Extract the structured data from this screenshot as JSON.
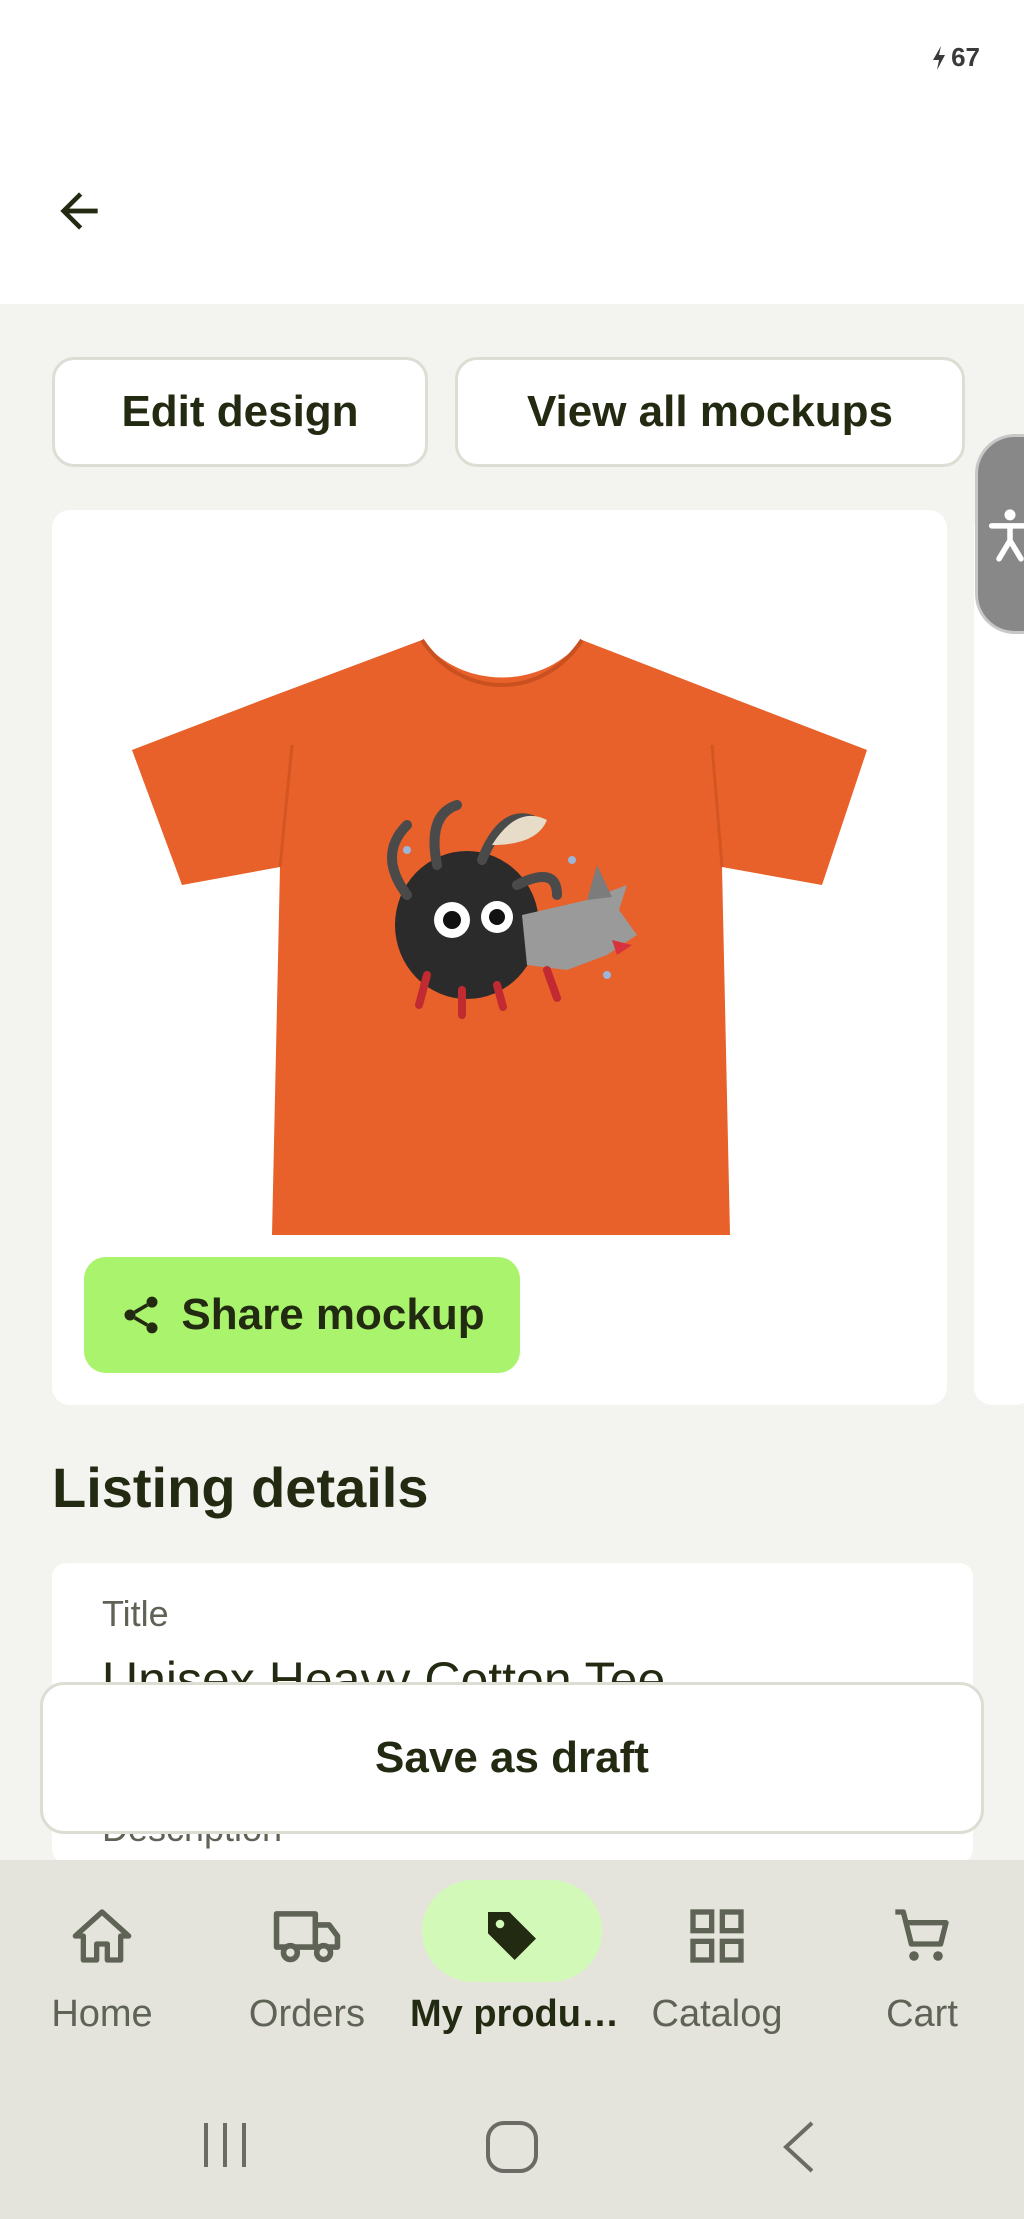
{
  "status_bar": {
    "battery": "67"
  },
  "actions": {
    "edit_design": "Edit design",
    "view_all_mockups": "View all mockups"
  },
  "mockup": {
    "product_color": "#e8602a",
    "share_label": "Share mockup"
  },
  "listing": {
    "section_title": "Listing details",
    "title_label": "Title",
    "title_value": "Unisex Heavy Cotton Tee",
    "description_label": "Description"
  },
  "save_draft_label": "Save as draft",
  "bottom_nav": {
    "items": [
      {
        "label": "Home",
        "icon": "home-icon"
      },
      {
        "label": "Orders",
        "icon": "truck-icon"
      },
      {
        "label": "My produ…",
        "icon": "tag-icon",
        "active": true
      },
      {
        "label": "Catalog",
        "icon": "grid-icon"
      },
      {
        "label": "Cart",
        "icon": "cart-icon"
      }
    ]
  },
  "colors": {
    "accent": "#a9f46c",
    "active_pill": "#d3f9b8",
    "text_dark": "#232a12"
  }
}
